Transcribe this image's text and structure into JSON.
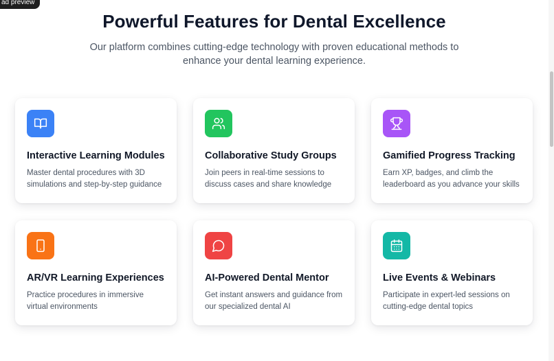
{
  "badge": {
    "label": "ad preview"
  },
  "header": {
    "title": "Powerful Features for Dental Excellence",
    "subtitle": "Our platform combines cutting-edge technology with proven educational methods to enhance your dental learning experience."
  },
  "features": [
    {
      "icon": "book-open-icon",
      "color": "#3b82f6",
      "title": "Interactive Learning Modules",
      "description": "Master dental procedures with 3D simulations and step-by-step guidance"
    },
    {
      "icon": "users-icon",
      "color": "#22c55e",
      "title": "Collaborative Study Groups",
      "description": "Join peers in real-time sessions to discuss cases and share knowledge"
    },
    {
      "icon": "trophy-icon",
      "color": "#a855f7",
      "title": "Gamified Progress Tracking",
      "description": "Earn XP, badges, and climb the leaderboard as you advance your skills"
    },
    {
      "icon": "smartphone-icon",
      "color": "#f97316",
      "title": "AR/VR Learning Experiences",
      "description": "Practice procedures in immersive virtual environments"
    },
    {
      "icon": "message-circle-icon",
      "color": "#ef4444",
      "title": "AI-Powered Dental Mentor",
      "description": "Get instant answers and guidance from our specialized dental AI"
    },
    {
      "icon": "calendar-icon",
      "color": "#14b8a6",
      "title": "Live Events & Webinars",
      "description": "Participate in expert-led sessions on cutting-edge dental topics"
    }
  ]
}
